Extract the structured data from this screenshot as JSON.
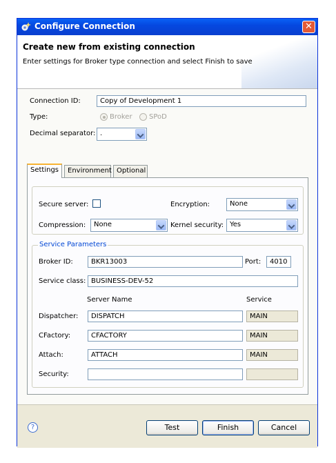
{
  "window": {
    "title": "Configure Connection",
    "close_glyph": "✕"
  },
  "header": {
    "title": "Create new from existing connection",
    "description": "Enter settings for Broker type connection and select Finish to save"
  },
  "form": {
    "connection_id_label": "Connection ID:",
    "connection_id_value": "Copy of Development 1",
    "type_label": "Type:",
    "type_options": [
      "Broker",
      "SPoD"
    ],
    "type_selected": "Broker",
    "decimal_separator_label": "Decimal separator:",
    "decimal_separator_value": "."
  },
  "tabs": [
    {
      "label": "Settings",
      "active": true
    },
    {
      "label": "Environment",
      "active": false
    },
    {
      "label": "Optional",
      "active": false
    }
  ],
  "settings": {
    "secure_server_label": "Secure server:",
    "secure_server_checked": false,
    "encryption_label": "Encryption:",
    "encryption_value": "None",
    "compression_label": "Compression:",
    "compression_value": "None",
    "kernel_security_label": "Kernel security:",
    "kernel_security_value": "Yes"
  },
  "service_parameters": {
    "group_title": "Service Parameters",
    "broker_id_label": "Broker ID:",
    "broker_id_value": "BKR13003",
    "port_label": "Port:",
    "port_value": "4010",
    "service_class_label": "Service class:",
    "service_class_value": "BUSINESS-DEV-52",
    "col_server_name": "Server Name",
    "col_service": "Service",
    "rows": [
      {
        "label": "Dispatcher:",
        "server_name": "DISPATCH",
        "service": "MAIN"
      },
      {
        "label": "CFactory:",
        "server_name": "CFACTORY",
        "service": "MAIN"
      },
      {
        "label": "Attach:",
        "server_name": "ATTACH",
        "service": "MAIN"
      },
      {
        "label": "Security:",
        "server_name": "",
        "service": ""
      }
    ]
  },
  "footer": {
    "help_glyph": "?",
    "test_label": "Test",
    "finish_label": "Finish",
    "cancel_label": "Cancel"
  },
  "colors": {
    "titlebar": "#0548e0",
    "accent_tab": "#f8b332",
    "group_title": "#0046d5"
  }
}
